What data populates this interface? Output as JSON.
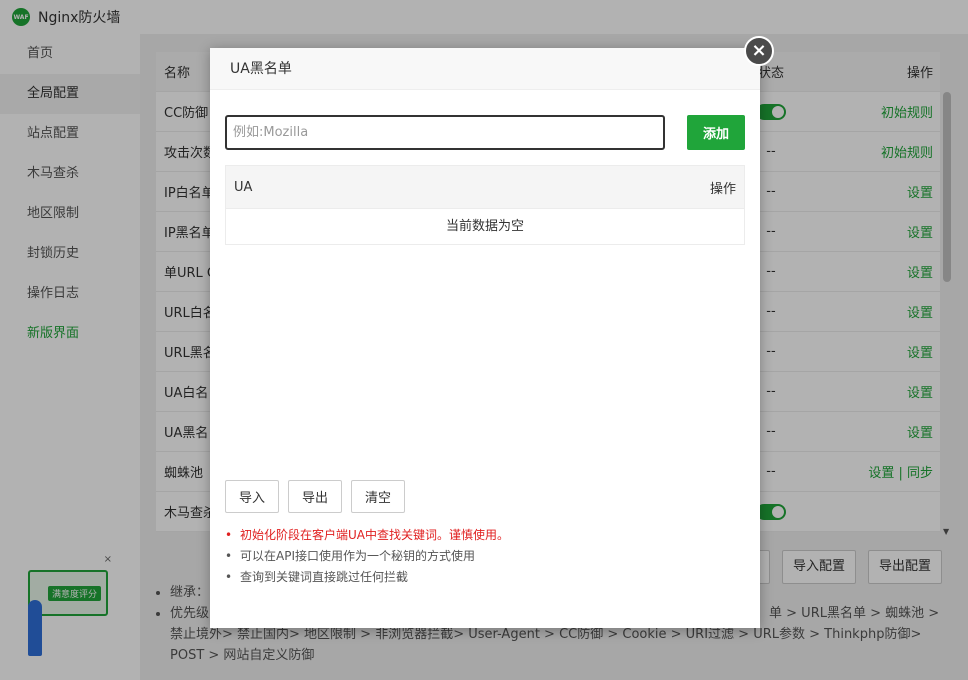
{
  "app": {
    "title": "Nginx防火墙",
    "logo_text": "WAF"
  },
  "sidebar": {
    "items": [
      {
        "label": "首页"
      },
      {
        "label": "全局配置"
      },
      {
        "label": "站点配置"
      },
      {
        "label": "木马查杀"
      },
      {
        "label": "地区限制"
      },
      {
        "label": "封锁历史"
      },
      {
        "label": "操作日志"
      },
      {
        "label": "新版界面"
      }
    ]
  },
  "feedback": {
    "label": "满意度评分",
    "close": "×"
  },
  "table": {
    "headers": {
      "name": "名称",
      "status": "状态",
      "op": "操作"
    },
    "rows": [
      {
        "name": "CC防御",
        "status": "",
        "op": "初始规则"
      },
      {
        "name": "攻击次数",
        "status": "--",
        "op": "初始规则"
      },
      {
        "name": "IP白名单",
        "status": "--",
        "op": "设置"
      },
      {
        "name": "IP黑名单",
        "status": "--",
        "op": "设置"
      },
      {
        "name": "单URL C",
        "status": "--",
        "op": "设置"
      },
      {
        "name": "URL白名",
        "status": "--",
        "op": "设置"
      },
      {
        "name": "URL黑名",
        "status": "--",
        "op": "设置"
      },
      {
        "name": "UA白名",
        "status": "--",
        "op": "设置"
      },
      {
        "name": "UA黑名",
        "status": "--",
        "op": "设置"
      },
      {
        "name": "蜘蛛池",
        "status": "--",
        "op": "设置 | 同步"
      },
      {
        "name": "木马查杀",
        "status": "",
        "op": ""
      }
    ]
  },
  "config_buttons": {
    "import": "导入配置",
    "export": "导出配置"
  },
  "notes": {
    "line1": "继承：",
    "line2a": "优先级",
    "line2b": "单 > URL黑名单 > 蜘蛛池 >",
    "line3": "禁止境外> 禁止国内> 地区限制 > 非浏览器拦截> User-Agent > CC防御 > Cookie > URI过滤 > URL参数 > Thinkphp防御>",
    "line4": "POST > 网站自定义防御"
  },
  "modal": {
    "title": "UA黑名单",
    "close": "×",
    "input_placeholder": "例如:Mozilla",
    "input_value": "",
    "add_label": "添加",
    "table_headers": {
      "ua": "UA",
      "op": "操作"
    },
    "empty_text": "当前数据为空",
    "buttons": {
      "import": "导入",
      "export": "导出",
      "clear": "清空"
    },
    "tips": [
      "初始化阶段在客户端UA中查找关键词。谨慎使用。",
      "可以在API接口使用作为一个秘钥的方式使用",
      "查询到关键词直接跳过任何拦截"
    ]
  }
}
